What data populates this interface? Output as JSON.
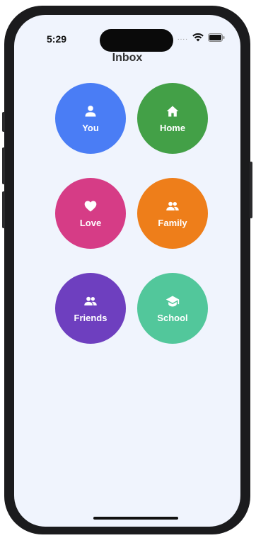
{
  "status": {
    "time": "5:29",
    "signal_dots": "...."
  },
  "header": {
    "title": "Inbox"
  },
  "categories": [
    {
      "label": "You",
      "icon": "person-icon",
      "color": "#4A7DF5"
    },
    {
      "label": "Home",
      "icon": "home-icon",
      "color": "#43A047"
    },
    {
      "label": "Love",
      "icon": "heart-icon",
      "color": "#D63C86"
    },
    {
      "label": "Family",
      "icon": "people-icon",
      "color": "#EE7E1A"
    },
    {
      "label": "Friends",
      "icon": "people-icon",
      "color": "#6E3FBF"
    },
    {
      "label": "School",
      "icon": "school-icon",
      "color": "#52C79B"
    }
  ]
}
